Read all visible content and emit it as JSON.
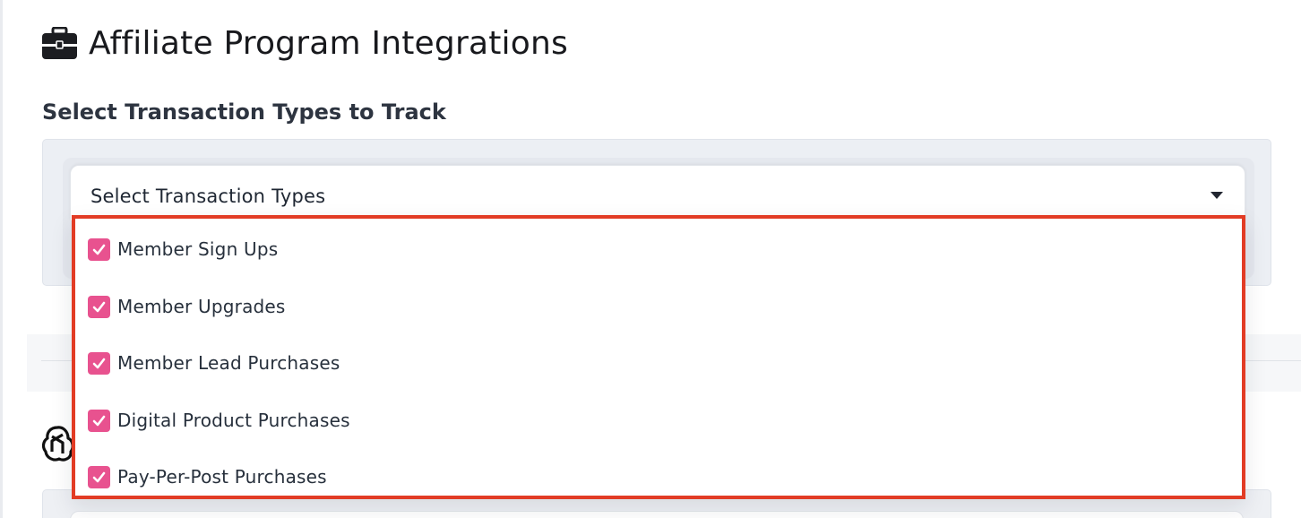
{
  "page": {
    "title": "Affiliate Program Integrations",
    "title_icon": "briefcase-icon"
  },
  "transaction_section": {
    "label": "Select Transaction Types to Track",
    "select": {
      "placeholder": "Select Transaction Types",
      "caret_icon": "caret-down-icon",
      "options": [
        {
          "label": "Member Sign Ups",
          "checked": true
        },
        {
          "label": "Member Upgrades",
          "checked": true
        },
        {
          "label": "Member Lead Purchases",
          "checked": true
        },
        {
          "label": "Digital Product Purchases",
          "checked": true
        },
        {
          "label": "Pay-Per-Post Purchases",
          "checked": true
        }
      ]
    }
  },
  "colors": {
    "checkbox_fill": "#e8528f",
    "highlight_border": "#e23c25",
    "panel_background": "#eceff4"
  },
  "lower_section": {
    "icon": "openai-logo-icon"
  }
}
